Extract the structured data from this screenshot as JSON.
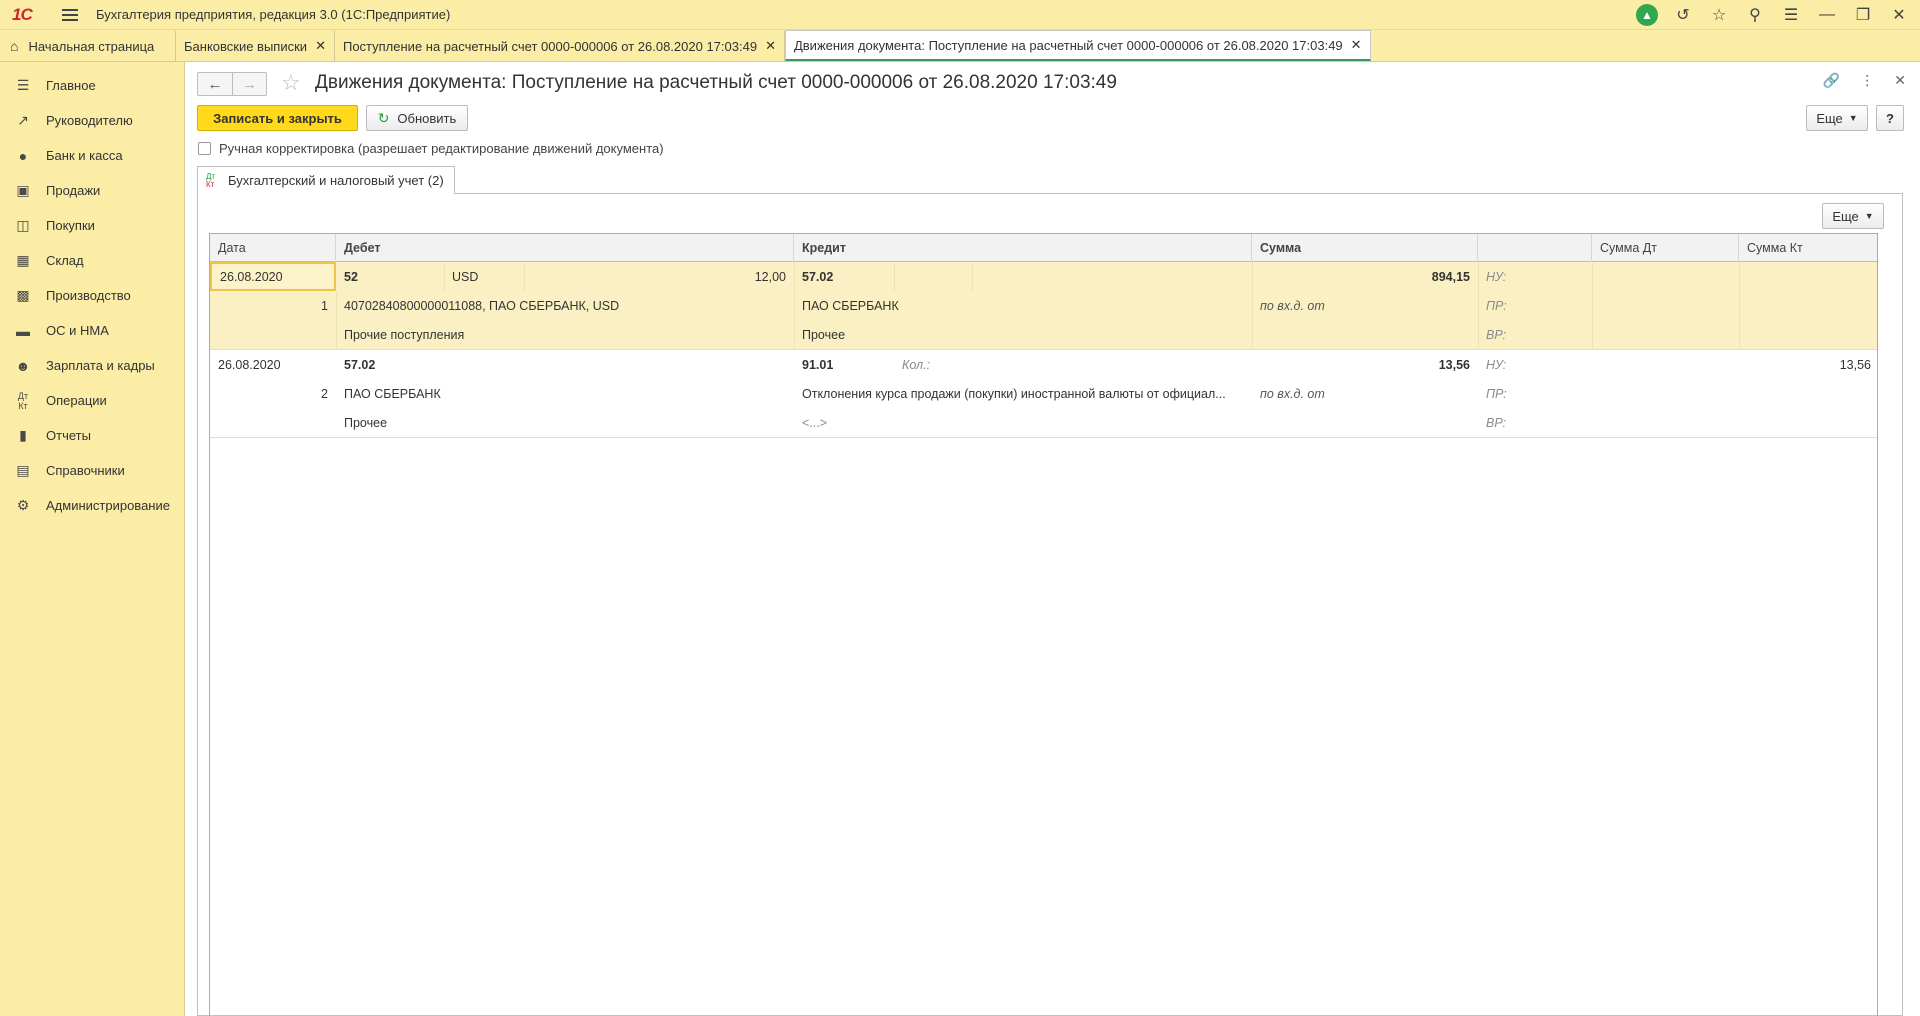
{
  "app": {
    "title": "Бухгалтерия предприятия, редакция 3.0  (1С:Предприятие)",
    "logo": "1С"
  },
  "tabs": [
    {
      "label": "Начальная страница"
    },
    {
      "label": "Банковские выписки"
    },
    {
      "label": "Поступление на расчетный счет 0000-000006 от 26.08.2020 17:03:49"
    },
    {
      "label": "Движения документа: Поступление на расчетный счет 0000-000006 от 26.08.2020 17:03:49"
    }
  ],
  "sidebar": {
    "items": [
      {
        "label": "Главное",
        "icon": "menu-icon"
      },
      {
        "label": "Руководителю",
        "icon": "trend-icon"
      },
      {
        "label": "Банк и касса",
        "icon": "ruble-icon"
      },
      {
        "label": "Продажи",
        "icon": "bag-icon"
      },
      {
        "label": "Покупки",
        "icon": "cart-icon"
      },
      {
        "label": "Склад",
        "icon": "grid-icon"
      },
      {
        "label": "Производство",
        "icon": "factory-icon"
      },
      {
        "label": "ОС и НМА",
        "icon": "truck-icon"
      },
      {
        "label": "Зарплата и кадры",
        "icon": "person-icon"
      },
      {
        "label": "Операции",
        "icon": "dtkt-icon"
      },
      {
        "label": "Отчеты",
        "icon": "bar-chart-icon"
      },
      {
        "label": "Справочники",
        "icon": "books-icon"
      },
      {
        "label": "Администрирование",
        "icon": "gear-icon"
      }
    ]
  },
  "document": {
    "title": "Движения документа: Поступление на расчетный счет 0000-000006 от 26.08.2020 17:03:49",
    "save_close_label": "Записать и закрыть",
    "refresh_label": "Обновить",
    "more_label": "Еще",
    "help_label": "?",
    "manual_correction_label": "Ручная корректировка (разрешает редактирование движений документа)",
    "register_tab_label": "Бухгалтерский и налоговый учет (2)"
  },
  "table": {
    "headers": {
      "date": "Дата",
      "debit": "Дебет",
      "credit": "Кредит",
      "sum": "Сумма",
      "blank": "",
      "sum_dt": "Сумма Дт",
      "sum_kt": "Сумма Кт"
    },
    "records": [
      {
        "date": "26.08.2020",
        "num": "1",
        "debit_account": "52",
        "debit_currency": "USD",
        "debit_amount": "12,00",
        "debit_sub1": "40702840800000011088, ПАО СБЕРБАНК, USD",
        "debit_sub2": "Прочие поступления",
        "credit_account": "57.02",
        "credit_extra": "",
        "credit_sub1": "ПАО СБЕРБАНК",
        "credit_sub2": "Прочее",
        "sum": "894,15",
        "sum_note": "по вх.д.  от",
        "nu": "НУ:",
        "pr": "ПР:",
        "vr": "ВР:",
        "sum_dt": "",
        "sum_kt": ""
      },
      {
        "date": "26.08.2020",
        "num": "2",
        "debit_account": "57.02",
        "debit_currency": "",
        "debit_amount": "",
        "debit_sub1": "ПАО СБЕРБАНК",
        "debit_sub2": "Прочее",
        "credit_account": "91.01",
        "credit_extra": "Кол.:",
        "credit_sub1": "Отклонения курса продажи (покупки) иностранной валюты от официал...",
        "credit_sub2": "<...>",
        "sum": "13,56",
        "sum_note": "по вх.д.  от",
        "nu": "НУ:",
        "pr": "ПР:",
        "vr": "ВР:",
        "sum_dt": "",
        "sum_kt": "13,56"
      }
    ]
  }
}
